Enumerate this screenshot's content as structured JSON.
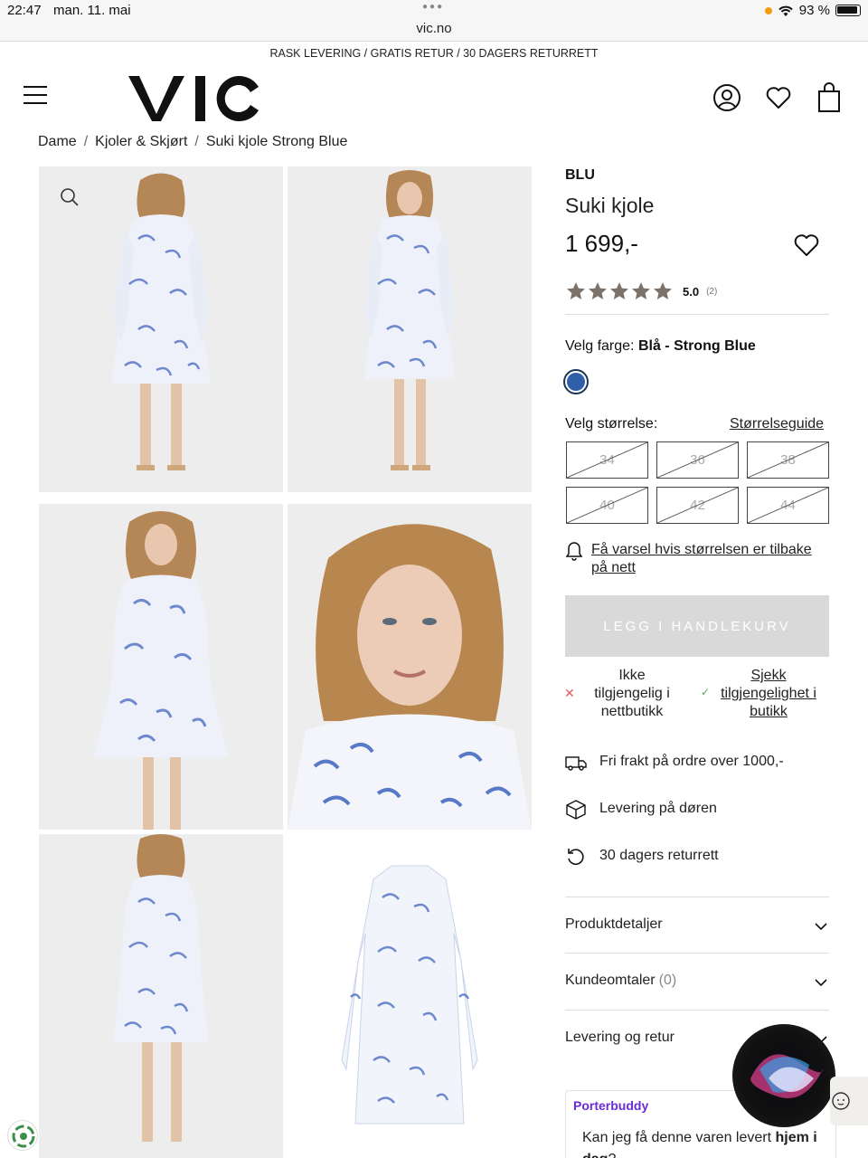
{
  "status_bar": {
    "time": "22:47",
    "date": "man. 11. mai",
    "url": "vic.no",
    "battery": "93 %"
  },
  "promo": "RASK LEVERING / GRATIS RETUR / 30 DAGERS RETURRETT",
  "header": {
    "logo": "VIC"
  },
  "breadcrumb": [
    {
      "label": "Dame"
    },
    {
      "label": "Kjoler & Skjørt"
    },
    {
      "label": "Suki kjole Strong Blue"
    }
  ],
  "breadcrumb_sep": "/",
  "product": {
    "brand": "BLU",
    "name": "Suki kjole",
    "price": "1 699,-",
    "rating": "5.0",
    "rating_count": "(2)",
    "stars_filled": 5
  },
  "color": {
    "label": "Velg farge:",
    "selected": "Blå - Strong Blue",
    "swatch": "#2e5fa8"
  },
  "size": {
    "label": "Velg størrelse:",
    "guide_link": "Størrelseguide",
    "options": [
      {
        "label": "34",
        "available": false
      },
      {
        "label": "36",
        "available": false
      },
      {
        "label": "38",
        "available": false
      },
      {
        "label": "40",
        "available": false
      },
      {
        "label": "42",
        "available": false
      },
      {
        "label": "44",
        "available": false
      }
    ]
  },
  "notify_link": "Få varsel hvis størrelsen er tilbake på nett",
  "cart_button": "LEGG I HANDLEKURV",
  "availability": {
    "online": "Ikke tilgjengelig i nettbutikk",
    "store_link": "Sjekk tilgjengelighet i butikk"
  },
  "usps": [
    {
      "icon": "truck-icon",
      "text": "Fri frakt på ordre over 1000,-"
    },
    {
      "icon": "package-icon",
      "text": "Levering på døren"
    },
    {
      "icon": "return-icon",
      "text": "30 dagers returrett"
    }
  ],
  "accordions": [
    {
      "label": "Produktdetaljer",
      "count": ""
    },
    {
      "label": "Kundeomtaler",
      "count": "(0)"
    },
    {
      "label": "Levering og retur",
      "count": ""
    }
  ],
  "porterbuddy": {
    "title": "Porterbuddy",
    "text_before": "Kan jeg få denne varen levert ",
    "text_bold": "hjem i dag",
    "text_after": "?"
  },
  "colors": {
    "accent": "#111111",
    "disabled_button": "#d9d9d9",
    "porter_purple": "#6a2bd9",
    "star": "#7a7269"
  }
}
